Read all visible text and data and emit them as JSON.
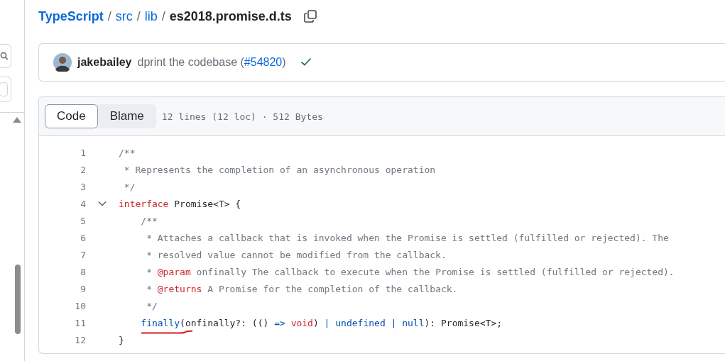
{
  "breadcrumb": [
    {
      "text": "TypeScript",
      "kind": "repo"
    },
    {
      "text": "/",
      "kind": "separator"
    },
    {
      "text": "src",
      "kind": "link"
    },
    {
      "text": "/",
      "kind": "separator"
    },
    {
      "text": "lib",
      "kind": "link"
    },
    {
      "text": "/",
      "kind": "separator"
    },
    {
      "text": "es2018.promise.d.ts",
      "kind": "current"
    }
  ],
  "commit": {
    "author": "jakebailey",
    "message": "dprint the codebase (",
    "pr": "#54820",
    "message_end": ")",
    "passed": true
  },
  "file_header": {
    "tabs": [
      {
        "label": "Code",
        "selected": true
      },
      {
        "label": "Blame",
        "selected": false
      }
    ],
    "info": "12 lines (12 loc) · 512 Bytes"
  },
  "code_lines": [
    {
      "number": "1",
      "foldable": false,
      "tokens": [
        {
          "text": "/**",
          "kind": "comment"
        }
      ]
    },
    {
      "number": "2",
      "foldable": false,
      "tokens": [
        {
          "text": " * Represents the completion of an asynchronous operation",
          "kind": "comment"
        }
      ]
    },
    {
      "number": "3",
      "foldable": false,
      "tokens": [
        {
          "text": " */",
          "kind": "comment"
        }
      ]
    },
    {
      "number": "4",
      "foldable": true,
      "tokens": [
        {
          "text": "interface",
          "kind": "keyword"
        },
        {
          "text": " Promise<T> {",
          "kind": "plain"
        }
      ]
    },
    {
      "number": "5",
      "foldable": false,
      "tokens": [
        {
          "text": "    /**",
          "kind": "comment"
        }
      ]
    },
    {
      "number": "6",
      "foldable": false,
      "tokens": [
        {
          "text": "     * Attaches a callback that is invoked when the Promise is settled (fulfilled or rejected). The",
          "kind": "comment"
        }
      ]
    },
    {
      "number": "7",
      "foldable": false,
      "tokens": [
        {
          "text": "     * resolved value cannot be modified from the callback.",
          "kind": "comment"
        }
      ]
    },
    {
      "number": "8",
      "foldable": false,
      "tokens": [
        {
          "text": "     * ",
          "kind": "comment"
        },
        {
          "text": "@param",
          "kind": "keyword"
        },
        {
          "text": " onfinally The callback to execute when the Promise is settled (fulfilled or rejected).",
          "kind": "comment"
        }
      ]
    },
    {
      "number": "9",
      "foldable": false,
      "tokens": [
        {
          "text": "     * ",
          "kind": "comment"
        },
        {
          "text": "@returns",
          "kind": "keyword"
        },
        {
          "text": " A Promise for the completion of the callback.",
          "kind": "comment"
        }
      ]
    },
    {
      "number": "10",
      "foldable": false,
      "tokens": [
        {
          "text": "     */",
          "kind": "comment"
        }
      ]
    },
    {
      "number": "11",
      "foldable": false,
      "underlined": true,
      "tokens": [
        {
          "text": "    finally",
          "kind": "entity"
        },
        {
          "text": "(onfinally?: (() ",
          "kind": "plain"
        },
        {
          "text": "=>",
          "kind": "entity"
        },
        {
          "text": " void",
          "kind": "keyword"
        },
        {
          "text": ") ",
          "kind": "plain"
        },
        {
          "text": "| undefined | null",
          "kind": "entity"
        },
        {
          "text": "): Promise<T>;",
          "kind": "plain"
        }
      ]
    },
    {
      "number": "12",
      "foldable": false,
      "tokens": [
        {
          "text": "}",
          "kind": "plain"
        }
      ]
    }
  ]
}
